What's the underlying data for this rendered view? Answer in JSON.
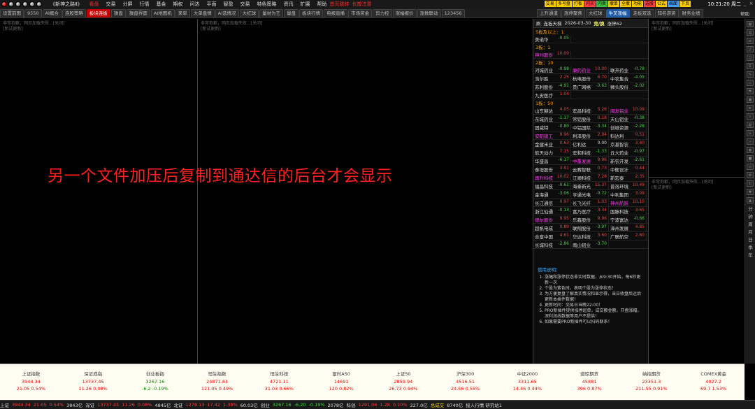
{
  "title_bar": {
    "app_title": "《新神之路Ⅱ》",
    "menus": [
      "看盘",
      "交易",
      "分屏",
      "行情",
      "基金",
      "期权",
      "问达",
      "平面",
      "智盈",
      "交易",
      "特色策略",
      "资讯",
      "扩展",
      "帮助"
    ],
    "active_menu": "看盘",
    "overlay_text": [
      "首页跳转",
      "长按注意"
    ],
    "tool_buttons": [
      {
        "label": "交易",
        "color": "#ffcc00"
      },
      {
        "label": "多号盘",
        "color": "#ffcc00"
      },
      {
        "label": "打板",
        "color": "#ffcc00"
      },
      {
        "label": "闪买",
        "color": "#ff4040"
      },
      {
        "label": "闪卖",
        "color": "#40c040"
      },
      {
        "label": "撤单",
        "color": "#ffcc00"
      },
      {
        "label": "全撤",
        "color": "#ffcc00"
      },
      {
        "label": "功能",
        "color": "#ffcc00"
      },
      {
        "label": "选股",
        "color": "#ff4040"
      },
      {
        "label": "公式",
        "color": "#ffcc00"
      },
      {
        "label": "画面",
        "color": "#40a0ff"
      },
      {
        "label": "下页",
        "color": "#ffcc00"
      }
    ],
    "clock": "10:21:20 周二"
  },
  "tabs": [
    "设置前图",
    "9550",
    "AI概合",
    "连股策略",
    "板块连板",
    "操盘",
    "操盘界面",
    "AI地图机",
    "来单",
    "大单盘情",
    "AI选情况",
    "大红球",
    "量材为王",
    "量盘",
    "板块行情",
    "电报直播",
    "市场资金",
    "剪力控",
    "涨幅报价",
    "涨数联动",
    "123456"
  ],
  "active_tab": "板块连板",
  "right_tabs": [
    "上升通道",
    "涨停聚焦",
    "大红球",
    "牛叉涨幅",
    "走板双选",
    "知名游资",
    "财务业绩"
  ],
  "right_active_tab": "牛叉涨幅",
  "help_label": "帮助",
  "pane_msg": [
    "非常抱歉，网页加载失败...[关闭]",
    "[新试更新]"
  ],
  "limit_up": {
    "header": {
      "refresh": "刷",
      "item": "连板天梯",
      "date": "2026-03-30",
      "mode": "竞/换",
      "count": "涨停62"
    },
    "sections": [
      {
        "title": "5板及以上：1",
        "rows": [
          [
            {
              "n": "美诺华",
              "c": "-0.05",
              "s": "dn",
              "k": ""
            }
          ]
        ]
      },
      {
        "title": "3板：1",
        "rows": [
          [
            {
              "n": "神州股份",
              "c": "10.00",
              "s": "up",
              "k": "pink"
            }
          ]
        ]
      },
      {
        "title": "2板：10",
        "rows": [
          [
            {
              "n": "河城药业",
              "c": "-0.98",
              "s": "dn",
              "k": ""
            },
            {
              "n": "康药药业",
              "c": "10.00",
              "s": "up",
              "k": "pink"
            },
            {
              "n": "联开药业",
              "c": "-0.78",
              "s": "dn",
              "k": ""
            }
          ],
          [
            {
              "n": "浩尔胜",
              "c": "2.25",
              "s": "up",
              "k": ""
            },
            {
              "n": "杭电股份",
              "c": "6.70",
              "s": "up",
              "k": ""
            },
            {
              "n": "中农集合",
              "c": "-4.05",
              "s": "dn",
              "k": ""
            }
          ],
          [
            {
              "n": "苏利股份",
              "c": "-4.91",
              "s": "dn",
              "k": ""
            },
            {
              "n": "贵广网络",
              "c": "-3.63",
              "s": "dn",
              "k": ""
            },
            {
              "n": "狮头股份",
              "c": "-2.02",
              "s": "dn",
              "k": ""
            }
          ],
          [
            {
              "n": "九安医疗",
              "c": "1.04",
              "s": "up",
              "k": ""
            }
          ]
        ]
      },
      {
        "title": "1板：50",
        "rows": [
          [
            {
              "n": "山东赫达",
              "c": "4.05",
              "s": "up",
              "k": ""
            },
            {
              "n": "宏昌科技",
              "c": "5.26",
              "s": "up",
              "k": ""
            },
            {
              "n": "闽发铝业",
              "c": "10.09",
              "s": "up",
              "k": "pink"
            }
          ],
          [
            {
              "n": "东城药业",
              "c": "-1.17",
              "s": "dn",
              "k": ""
            },
            {
              "n": "常铝股份",
              "c": "0.18",
              "s": "up",
              "k": ""
            },
            {
              "n": "天山铝业",
              "c": "-0.38",
              "s": "dn",
              "k": ""
            }
          ],
          [
            {
              "n": "固威特",
              "c": "-0.80",
              "s": "dn",
              "k": ""
            },
            {
              "n": "中铝国际",
              "c": "-3.34",
              "s": "dn",
              "k": ""
            },
            {
              "n": "创维资源",
              "c": "-2.28",
              "s": "dn",
              "k": ""
            }
          ],
          [
            {
              "n": "安阳建工",
              "c": "9.96",
              "s": "up",
              "k": "pink"
            },
            {
              "n": "利泽股份",
              "c": "2.94",
              "s": "up",
              "k": ""
            },
            {
              "n": "科达利",
              "c": "0.51",
              "s": "up",
              "k": ""
            }
          ],
          [
            {
              "n": "金健米业",
              "c": "0.63",
              "s": "up",
              "k": ""
            },
            {
              "n": "亿利达",
              "c": "0.00",
              "s": "fl",
              "k": ""
            },
            {
              "n": "京基智农",
              "c": "3.40",
              "s": "up",
              "k": ""
            }
          ],
          [
            {
              "n": "航天动力",
              "c": "7.15",
              "s": "up",
              "k": ""
            },
            {
              "n": "宏和科技",
              "c": "-1.33",
              "s": "dn",
              "k": ""
            },
            {
              "n": "丘大药业",
              "c": "-0.97",
              "s": "dn",
              "k": ""
            }
          ],
          [
            {
              "n": "华盛昌",
              "c": "-6.17",
              "s": "dn",
              "k": ""
            },
            {
              "n": "中重发展",
              "c": "9.96",
              "s": "up",
              "k": "pink"
            },
            {
              "n": "新农开发",
              "c": "-2.61",
              "s": "dn",
              "k": ""
            }
          ],
          [
            {
              "n": "泰坦股份",
              "c": "3.91",
              "s": "up",
              "k": ""
            },
            {
              "n": "云赛智联",
              "c": "0.73",
              "s": "up",
              "k": ""
            },
            {
              "n": "中衡设计",
              "c": "0.44",
              "s": "up",
              "k": ""
            }
          ],
          [
            {
              "n": "再升科技",
              "c": "10.02",
              "s": "up",
              "k": "pink"
            },
            {
              "n": "江顺科技",
              "c": "7.28",
              "s": "up",
              "k": ""
            },
            {
              "n": "新宏泰",
              "c": "2.35",
              "s": "up",
              "k": ""
            }
          ],
          [
            {
              "n": "福晶科技",
              "c": "-0.61",
              "s": "dn",
              "k": ""
            },
            {
              "n": "海泰新光",
              "c": "15.37",
              "s": "up",
              "k": ""
            },
            {
              "n": "普洛环境",
              "c": "10.49",
              "s": "up",
              "k": ""
            }
          ],
          [
            {
              "n": "金海通",
              "c": "-3.06",
              "s": "dn",
              "k": ""
            },
            {
              "n": "亨通光电",
              "c": "-0.72",
              "s": "dn",
              "k": ""
            },
            {
              "n": "中利集团",
              "c": "3.09",
              "s": "up",
              "k": ""
            }
          ],
          [
            {
              "n": "长江通信",
              "c": "0.97",
              "s": "up",
              "k": ""
            },
            {
              "n": "长飞光纤",
              "c": "1.03",
              "s": "up",
              "k": ""
            },
            {
              "n": "神州航跃",
              "c": "10.10",
              "s": "up",
              "k": "pink"
            }
          ],
          [
            {
              "n": "浙江仙通",
              "c": "-0.13",
              "s": "dn",
              "k": ""
            },
            {
              "n": "富乃医疗",
              "c": "3.34",
              "s": "up",
              "k": ""
            },
            {
              "n": "国脉科技",
              "c": "3.65",
              "s": "up",
              "k": ""
            }
          ],
          [
            {
              "n": "德尔股份",
              "c": "9.95",
              "s": "up",
              "k": "pink"
            },
            {
              "n": "乐鑫股份",
              "c": "9.96",
              "s": "up",
              "k": ""
            },
            {
              "n": "宁波富达",
              "c": "-0.66",
              "s": "dn",
              "k": ""
            }
          ],
          [
            {
              "n": "超帆电成",
              "c": "0.89",
              "s": "up",
              "k": ""
            },
            {
              "n": "联翔股份",
              "c": "-3.97",
              "s": "dn",
              "k": ""
            },
            {
              "n": "漳州发展",
              "c": "4.85",
              "s": "up",
              "k": ""
            }
          ],
          [
            {
              "n": "合富中国",
              "c": "4.61",
              "s": "up",
              "k": ""
            },
            {
              "n": "华达科技",
              "c": "3.60",
              "s": "up",
              "k": ""
            },
            {
              "n": "广联航空",
              "c": "2.80",
              "s": "up",
              "k": ""
            }
          ],
          [
            {
              "n": "长城科技",
              "c": "-2.86",
              "s": "dn",
              "k": ""
            },
            {
              "n": "南山铝业",
              "c": "-3.70",
              "s": "dn",
              "k": ""
            }
          ]
        ]
      }
    ]
  },
  "usage": {
    "title": "使用说明：",
    "items": [
      "涨幅和涨停状态非实时数据，从9:30开始，每6秒更新一次",
      "个股为紫色时，表明个股为涨停状态！",
      "为方便复盘了解真实情况和显示得，当日收盘后运后更新本插件数据！",
      "更新时间：交易日当晚22:00！",
      "PRO新插件提供涨停起单，成交额金额，开盘涨幅，深利润线数据等用户不提供！",
      "如果需要PRO新插件可以扫码联系！"
    ]
  },
  "overlay_message": "另一个文件加压后复制到通达信的后台才会显示",
  "sidebar_right": [
    "分",
    "钟",
    "周",
    "月",
    "日",
    "季",
    "年"
  ],
  "indices": [
    {
      "name": "上证指数",
      "value": "3944.34",
      "change": "21.05  0.54%",
      "dir": "up"
    },
    {
      "name": "深证成指",
      "value": "13737.45",
      "change": "11.26  0.08%",
      "dir": "up"
    },
    {
      "name": "创业板指",
      "value": "3267.16",
      "change": "-6.2  -0.19%",
      "dir": "dn"
    },
    {
      "name": "恒生指数",
      "value": "24871.84",
      "change": "121.05  0.49%",
      "dir": "up"
    },
    {
      "name": "恒生科技",
      "value": "4721.11",
      "change": "31.03  0.66%",
      "dir": "up"
    },
    {
      "name": "富时A50",
      "value": "14691",
      "change": "120  0.82%",
      "dir": "up"
    },
    {
      "name": "上证50",
      "value": "2859.94",
      "change": "26.73  0.94%",
      "dir": "up"
    },
    {
      "name": "沪深300",
      "value": "4516.51",
      "change": "24.56  0.55%",
      "dir": "up"
    },
    {
      "name": "中证2000",
      "value": "3311.65",
      "change": "14.46  0.44%",
      "dir": "up"
    },
    {
      "name": "道琼期货",
      "value": "45881",
      "change": "396  0.87%",
      "dir": "up"
    },
    {
      "name": "纳指期货",
      "value": "23351.3",
      "change": "211.55  0.91%",
      "dir": "up"
    },
    {
      "name": "COMEX黄金",
      "value": "4027.2",
      "change": "69.7  1.53%",
      "dir": "up"
    }
  ],
  "status_bar": [
    {
      "t": "上证",
      "c": "s-w"
    },
    {
      "t": "3944.34",
      "c": "s-up"
    },
    {
      "t": "21.05",
      "c": "s-up"
    },
    {
      "t": "0.54%",
      "c": "s-up"
    },
    {
      "t": "3843亿",
      "c": "s-w"
    },
    {
      "t": "深证",
      "c": "s-w"
    },
    {
      "t": "13737.45",
      "c": "s-up"
    },
    {
      "t": "11.26",
      "c": "s-up"
    },
    {
      "t": "0.08%",
      "c": "s-up"
    },
    {
      "t": "4845亿",
      "c": "s-w"
    },
    {
      "t": "北证",
      "c": "s-w"
    },
    {
      "t": "1278.13",
      "c": "s-up"
    },
    {
      "t": "17.42",
      "c": "s-up"
    },
    {
      "t": "1.38%",
      "c": "s-up"
    },
    {
      "t": "60.03亿",
      "c": "s-w"
    },
    {
      "t": "创业",
      "c": "s-w"
    },
    {
      "t": "3267.16",
      "c": "s-dn"
    },
    {
      "t": "-6.20",
      "c": "s-dn"
    },
    {
      "t": "-0.19%",
      "c": "s-dn"
    },
    {
      "t": "2078亿",
      "c": "s-w"
    },
    {
      "t": "科创",
      "c": "s-w"
    },
    {
      "t": "1291.06",
      "c": "s-up"
    },
    {
      "t": "1.28",
      "c": "s-up"
    },
    {
      "t": "0.10%",
      "c": "s-up"
    },
    {
      "t": "227.0亿",
      "c": "s-w"
    },
    {
      "t": "总成交",
      "c": "s-y"
    },
    {
      "t": "8740亿",
      "c": "s-w"
    },
    {
      "t": "接入行情 研究站1",
      "c": "s-w"
    }
  ]
}
